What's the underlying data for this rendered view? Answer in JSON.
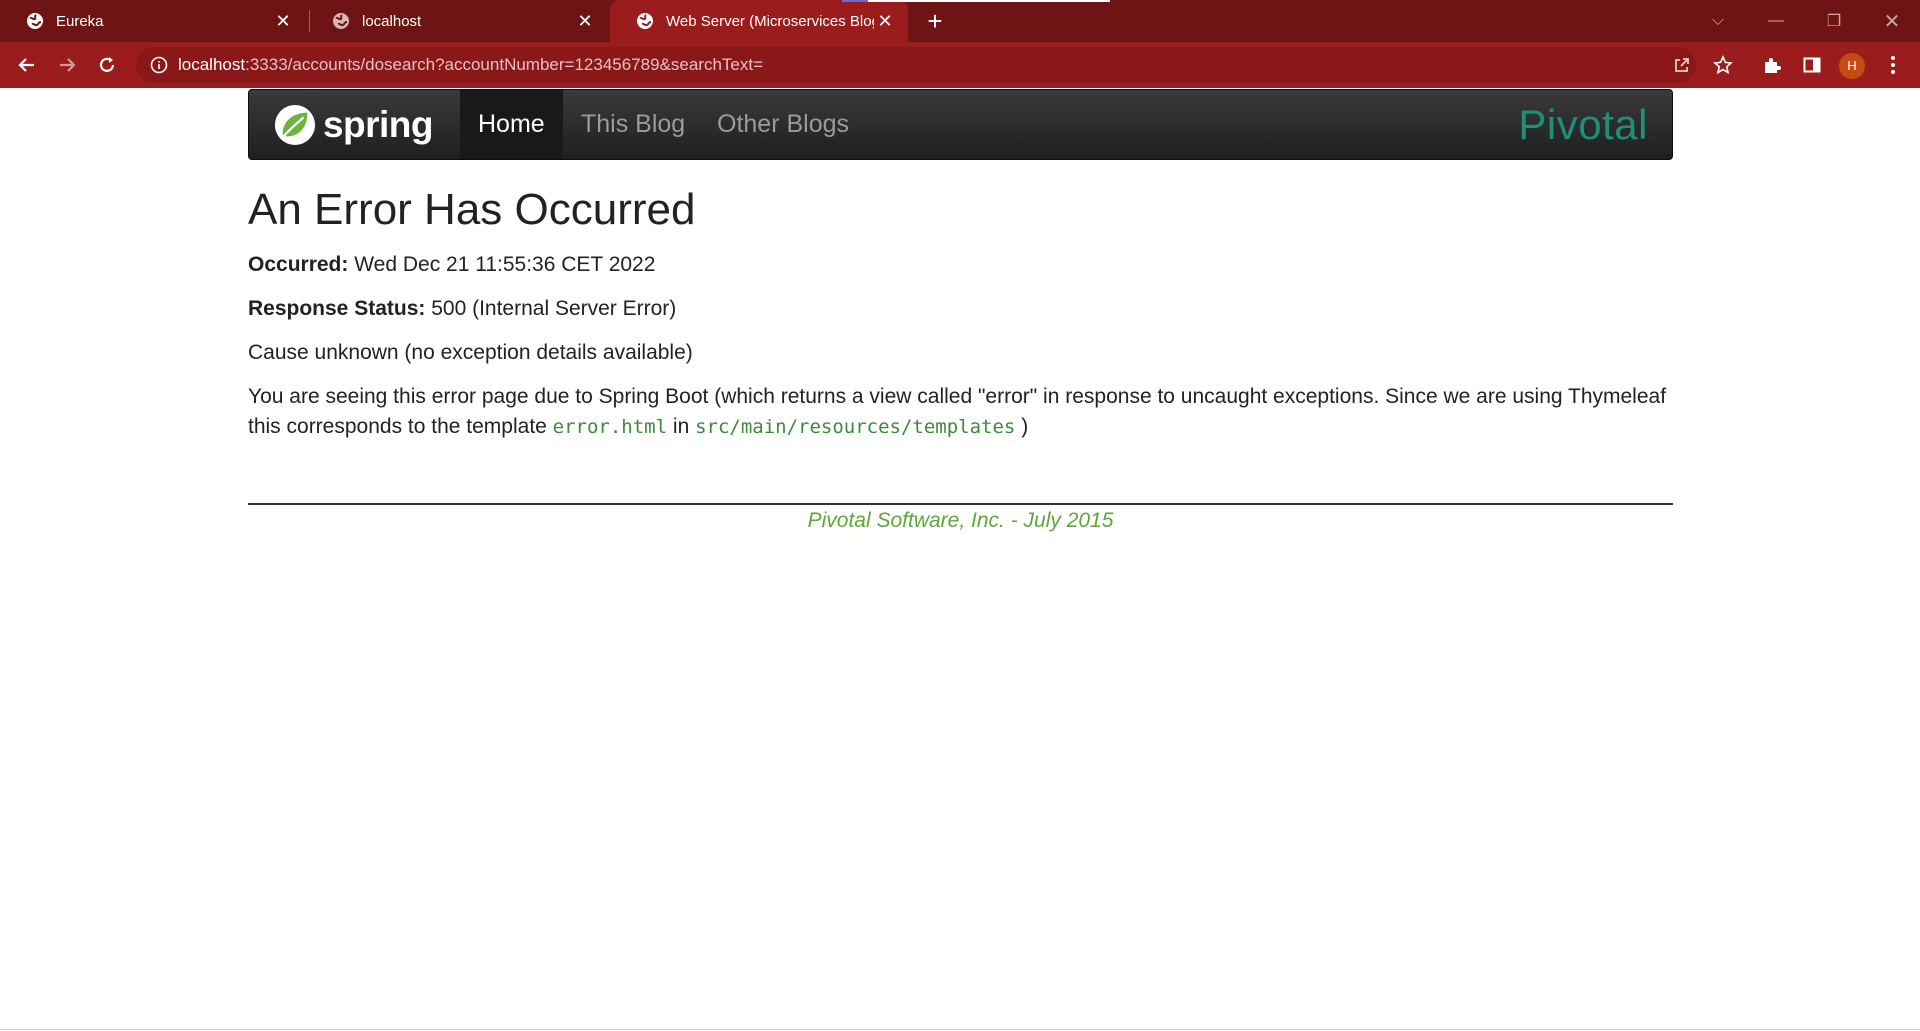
{
  "browser": {
    "tabs": [
      {
        "title": "Eureka",
        "active": false
      },
      {
        "title": "localhost",
        "active": false
      },
      {
        "title": "Web Server (Microservices Blog D",
        "active": true
      }
    ],
    "url_host": "localhost",
    "url_path": ":3333/accounts/dosearch?accountNumber=123456789&searchText=",
    "profile_initial": "H",
    "colors": {
      "tabstrip": "#6e1414",
      "toolbar": "#9b1c1c",
      "avatar": "#c64a12"
    }
  },
  "navbar": {
    "brand": "spring",
    "items": [
      {
        "label": "Home",
        "active": true
      },
      {
        "label": "This Blog",
        "active": false
      },
      {
        "label": "Other Blogs",
        "active": false
      }
    ],
    "partner_logo": "Pivotal"
  },
  "main": {
    "title": "An Error Has Occurred",
    "occurred_label": "Occurred:",
    "occurred_value": " Wed Dec 21 11:55:36 CET 2022",
    "status_label": "Response Status:",
    "status_value": " 500 (Internal Server Error)",
    "cause": "Cause unknown (no exception details available)",
    "explanation_part1": "You are seeing this error page due to Spring Boot (which returns a view called \"error\" in response to uncaught exceptions. Since we are using Thymeleaf this corresponds to the template ",
    "template_file": "error.html",
    "explanation_part2": " in ",
    "template_dir": "src/main/resources/templates",
    "explanation_part3": " )"
  },
  "footer": {
    "text": "Pivotal Software, Inc. - July 2015",
    "color": "#5ca83a"
  }
}
